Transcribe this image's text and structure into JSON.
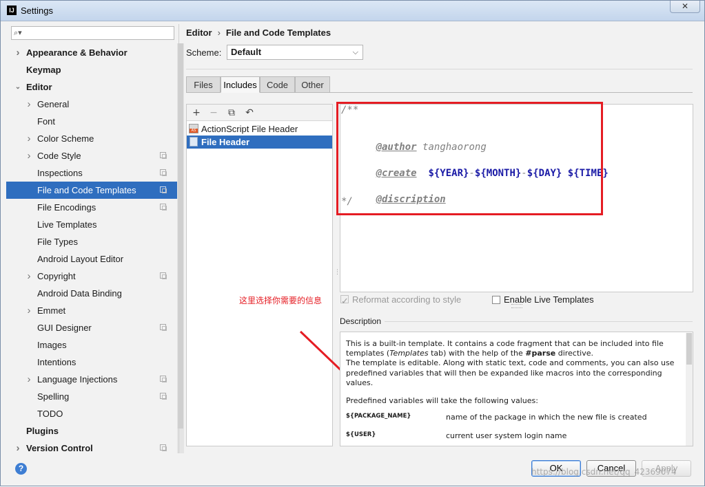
{
  "window": {
    "title": "Settings",
    "app_icon": "IJ",
    "close_glyph": "✕"
  },
  "sidebar": {
    "search_placeholder": "",
    "items": [
      {
        "label": "Appearance & Behavior",
        "level": 0,
        "bold": true,
        "chevron": "right",
        "copy": false,
        "selected": false
      },
      {
        "label": "Keymap",
        "level": 0,
        "bold": true,
        "chevron": "",
        "copy": false,
        "selected": false
      },
      {
        "label": "Editor",
        "level": 0,
        "bold": true,
        "chevron": "down",
        "copy": false,
        "selected": false
      },
      {
        "label": "General",
        "level": 1,
        "bold": false,
        "chevron": "right",
        "copy": false,
        "selected": false
      },
      {
        "label": "Font",
        "level": 1,
        "bold": false,
        "chevron": "",
        "copy": false,
        "selected": false
      },
      {
        "label": "Color Scheme",
        "level": 1,
        "bold": false,
        "chevron": "right",
        "copy": false,
        "selected": false
      },
      {
        "label": "Code Style",
        "level": 1,
        "bold": false,
        "chevron": "right",
        "copy": true,
        "selected": false
      },
      {
        "label": "Inspections",
        "level": 1,
        "bold": false,
        "chevron": "",
        "copy": true,
        "selected": false
      },
      {
        "label": "File and Code Templates",
        "level": 1,
        "bold": false,
        "chevron": "",
        "copy": true,
        "selected": true
      },
      {
        "label": "File Encodings",
        "level": 1,
        "bold": false,
        "chevron": "",
        "copy": true,
        "selected": false
      },
      {
        "label": "Live Templates",
        "level": 1,
        "bold": false,
        "chevron": "",
        "copy": false,
        "selected": false
      },
      {
        "label": "File Types",
        "level": 1,
        "bold": false,
        "chevron": "",
        "copy": false,
        "selected": false
      },
      {
        "label": "Android Layout Editor",
        "level": 1,
        "bold": false,
        "chevron": "",
        "copy": false,
        "selected": false
      },
      {
        "label": "Copyright",
        "level": 1,
        "bold": false,
        "chevron": "right",
        "copy": true,
        "selected": false
      },
      {
        "label": "Android Data Binding",
        "level": 1,
        "bold": false,
        "chevron": "",
        "copy": false,
        "selected": false
      },
      {
        "label": "Emmet",
        "level": 1,
        "bold": false,
        "chevron": "right",
        "copy": false,
        "selected": false
      },
      {
        "label": "GUI Designer",
        "level": 1,
        "bold": false,
        "chevron": "",
        "copy": true,
        "selected": false
      },
      {
        "label": "Images",
        "level": 1,
        "bold": false,
        "chevron": "",
        "copy": false,
        "selected": false
      },
      {
        "label": "Intentions",
        "level": 1,
        "bold": false,
        "chevron": "",
        "copy": false,
        "selected": false
      },
      {
        "label": "Language Injections",
        "level": 1,
        "bold": false,
        "chevron": "right",
        "copy": true,
        "selected": false
      },
      {
        "label": "Spelling",
        "level": 1,
        "bold": false,
        "chevron": "",
        "copy": true,
        "selected": false
      },
      {
        "label": "TODO",
        "level": 1,
        "bold": false,
        "chevron": "",
        "copy": false,
        "selected": false
      },
      {
        "label": "Plugins",
        "level": 0,
        "bold": true,
        "chevron": "",
        "copy": false,
        "selected": false
      },
      {
        "label": "Version Control",
        "level": 0,
        "bold": true,
        "chevron": "right",
        "copy": true,
        "selected": false
      }
    ]
  },
  "breadcrumb": {
    "root": "Editor",
    "separator": "›",
    "current": "File and Code Templates"
  },
  "scheme": {
    "label": "Scheme:",
    "value": "Default"
  },
  "tabs": [
    "Files",
    "Includes",
    "Code",
    "Other"
  ],
  "active_tab": "Includes",
  "templates": {
    "toolbar": {
      "add": "+",
      "remove": "−",
      "copy": "⧉",
      "reset": "↶"
    },
    "items": [
      {
        "label": "ActionScript File Header",
        "icon": "actionscript-icon",
        "icon_text": "AS",
        "selected": false
      },
      {
        "label": "File Header",
        "icon": "file-icon",
        "selected": true
      }
    ]
  },
  "editor": {
    "line1": "/**",
    "author_tag": "@author",
    "author_value": "tanghaorong",
    "create_tag": "@create",
    "var_year": "${YEAR}",
    "var_month": "${MONTH}",
    "var_day": "${DAY}",
    "var_time": "${TIME}",
    "dash": "-",
    "discription_tag": "@discription",
    "line_end": "*/"
  },
  "annotation": {
    "text": "这里选择你需要的信息",
    "color": "#e51c23"
  },
  "options": {
    "reformat_label": "Reformat according to style",
    "reformat_checked": true,
    "reformat_enabled": false,
    "live_label": "Enable Live Templates",
    "live_checked": false
  },
  "description": {
    "label": "Description",
    "p1_a": "This is a built-in template. It contains a code fragment that can be included into file templates (",
    "p1_italic": "Templates",
    "p1_b": " tab) with the help of the ",
    "p1_bold": "#parse",
    "p1_c": " directive.",
    "p2": "The template is editable. Along with static text, code and comments, you can also use predefined variables that will then be expanded like macros into the corresponding values.",
    "p3": "Predefined variables will take the following values:",
    "vars": [
      {
        "name": "${PACKAGE_NAME}",
        "desc": "name of the package in which the new file is created"
      },
      {
        "name": "${USER}",
        "desc": "current user system login name"
      }
    ]
  },
  "buttons": {
    "help": "?",
    "ok": "OK",
    "cancel": "Cancel",
    "apply": "Apply"
  },
  "watermark": "https://blog.csdn.net/qq_42369074",
  "colors": {
    "selection": "#2f6ebf",
    "highlight": "#e51c23",
    "template_var": "#1a1aa6"
  }
}
